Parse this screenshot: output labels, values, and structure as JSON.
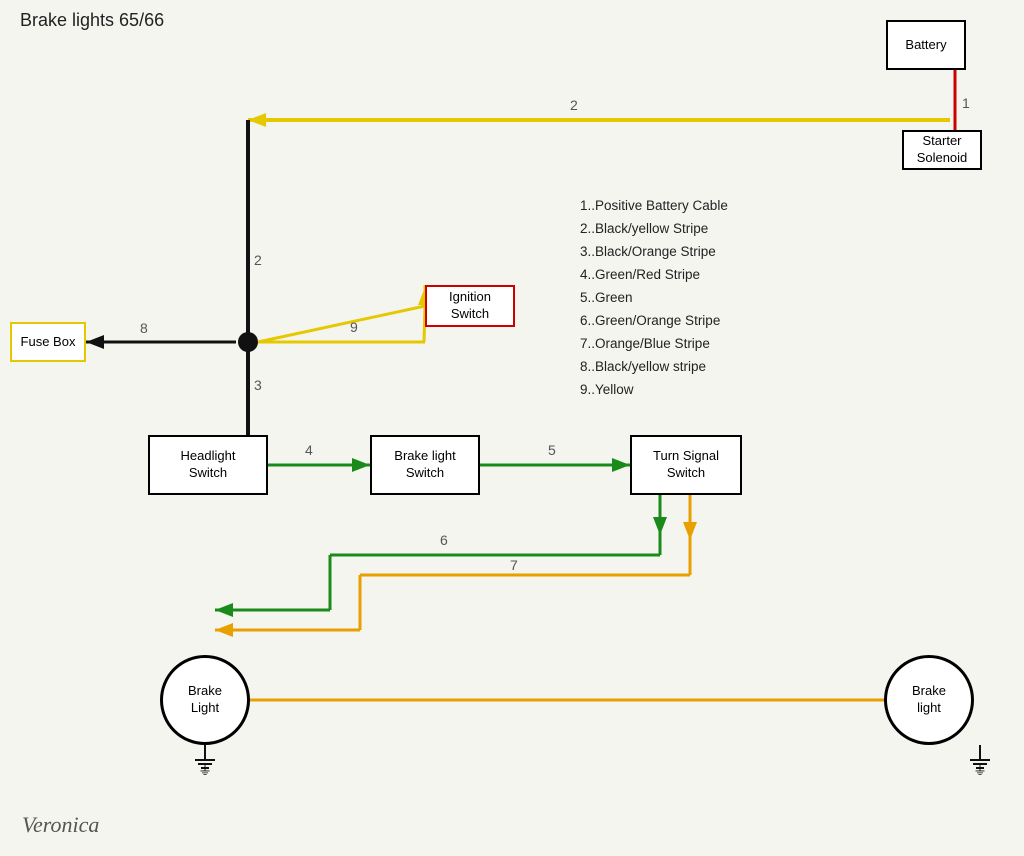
{
  "title": "Brake lights 65/66",
  "legend": {
    "items": [
      "1..Positive Battery Cable",
      "2..Black/yellow Stripe",
      "3..Black/Orange Stripe",
      "4..Green/Red Stripe",
      "5..Green",
      "6..Green/Orange Stripe",
      "7..Orange/Blue Stripe",
      "8..Black/yellow stripe",
      "9..Yellow"
    ]
  },
  "components": {
    "battery": "Battery",
    "starter": "Starter\nSolenoid",
    "fuse_box": "Fuse Box",
    "ignition": "Ignition\nSwitch",
    "headlight": "Headlight\nSwitch",
    "brakelight": "Brake light\nSwitch",
    "turnsignal": "Turn Signal\nSwitch",
    "brake_light_left": "Brake\nLight",
    "brake_light_right": "Brake\nlight"
  },
  "wire_labels": {
    "1": "1",
    "2_top": "2",
    "2_left": "2",
    "3": "3",
    "4": "4",
    "5": "5",
    "6": "6",
    "7": "7",
    "8": "8",
    "9": "9"
  },
  "signature": "Veronica",
  "colors": {
    "black": "#111111",
    "yellow": "#e6c800",
    "green": "#1a8a1a",
    "orange": "#e8a000",
    "red": "#cc0000",
    "light_green": "#00bb44"
  }
}
